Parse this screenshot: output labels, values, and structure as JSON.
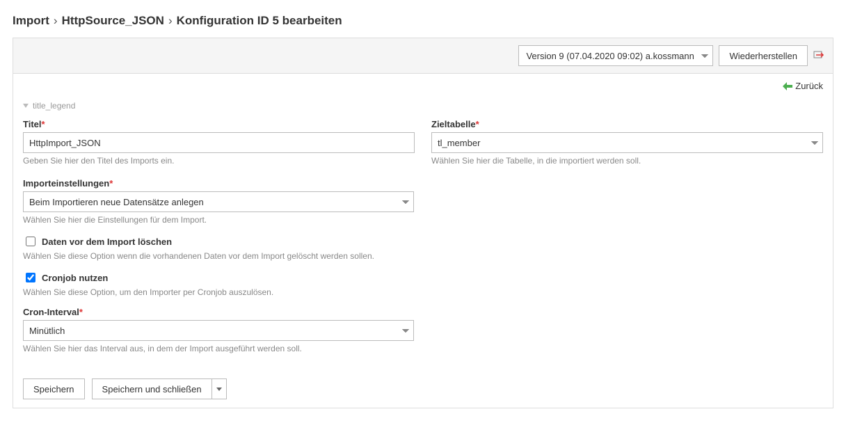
{
  "breadcrumb": {
    "root": "Import",
    "source": "HttpSource_JSON",
    "current": "Konfiguration ID 5 bearbeiten",
    "separator": "›"
  },
  "header": {
    "version_selected": "Version 9 (07.04.2020 09:02) a.kossmann",
    "restore_label": "Wiederherstellen"
  },
  "subheader": {
    "back_label": "Zurück"
  },
  "legend": {
    "title": "title_legend"
  },
  "fields": {
    "title": {
      "label": "Titel",
      "value": "HttpImport_JSON",
      "help": "Geben Sie hier den Titel des Imports ein."
    },
    "target_table": {
      "label": "Zieltabelle",
      "value": "tl_member",
      "help": "Wählen Sie hier die Tabelle, in die importiert werden soll."
    },
    "import_settings": {
      "label": "Importeinstellungen",
      "value": "Beim Importieren neue Datensätze anlegen",
      "help": "Wählen Sie hier die Einstellungen für dem Import."
    },
    "delete_before": {
      "label": "Daten vor dem Import löschen",
      "checked": false,
      "help": "Wählen Sie diese Option wenn die vorhandenen Daten vor dem Import gelöscht werden sollen."
    },
    "use_cron": {
      "label": "Cronjob nutzen",
      "checked": true,
      "help": "Wählen Sie diese Option, um den Importer per Cronjob auszulösen."
    },
    "cron_interval": {
      "label": "Cron-Interval",
      "value": "Minütlich",
      "help": "Wählen Sie hier das Interval aus, in dem der Import ausgeführt werden soll."
    }
  },
  "footer": {
    "save": "Speichern",
    "save_close": "Speichern und schließen"
  }
}
